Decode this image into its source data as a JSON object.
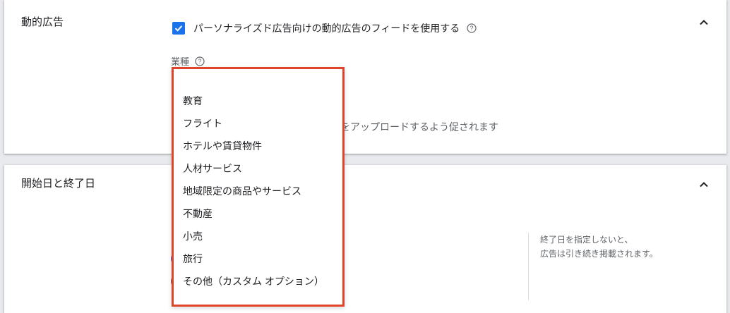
{
  "dynamic_ads": {
    "title": "動的広告",
    "checkbox_label": "パーソナライズド広告向けの動的広告のフィードを使用する",
    "checkbox_checked": true,
    "industry_label": "業種",
    "hint_partial": "ドをアップロードするよう促されます",
    "collapse_icon": "chevron-up-icon",
    "help_icon": "help-circle-icon"
  },
  "dates": {
    "title": "開始日と終了日",
    "collapse_icon": "chevron-up-icon",
    "note_line1": "終了日を指定しないと、",
    "note_line2": "広告は引き続き掲載されます。"
  },
  "industry_dropdown": {
    "options": [
      "教育",
      "フライト",
      "ホテルや賃貸物件",
      "人材サービス",
      "地域限定の商品やサービス",
      "不動産",
      "小売",
      "旅行",
      "その他（カスタム オプション）"
    ]
  },
  "colors": {
    "accent": "#1a73e8",
    "highlight_border": "#e0442b"
  }
}
